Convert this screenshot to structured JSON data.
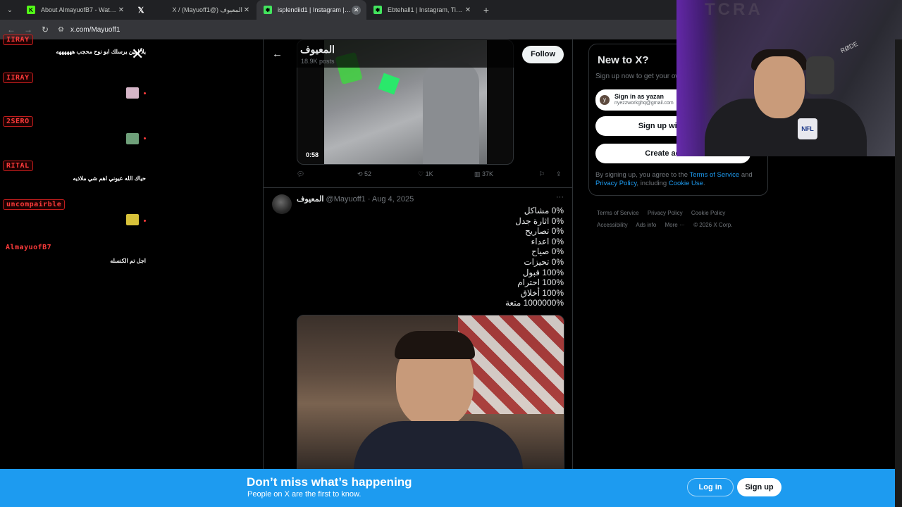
{
  "browser": {
    "tabs": [
      {
        "title": "About AlmayuofB7 - Watch Live",
        "icon": "kick-icon"
      },
      {
        "title": "",
        "icon": "x-icon"
      },
      {
        "title": "X / (Mayuoff1@) المعيوف",
        "icon": ""
      },
      {
        "title": "isplendiid1 | Instagram | Linktree",
        "icon": "linktree-icon"
      },
      {
        "title": "Ebtehall1 | Instagram, TikTok | L",
        "icon": "linktree-icon"
      }
    ],
    "url": "x.com/Mayuoff1"
  },
  "chat": [
    {
      "user": "IIRAY",
      "message": "يلاً امين يرسلك ابو نوح محجب ههههههه"
    },
    {
      "user": "IIRAY",
      "message": ""
    },
    {
      "user": "2SERO",
      "message": ""
    },
    {
      "user": "RITAL",
      "message": "حياك الله عيوني اهم شي ملاذيه"
    },
    {
      "user": "uncompairble",
      "message": ""
    },
    {
      "user": "AlmayuofB7",
      "message": "اجل تم الكنسله"
    }
  ],
  "profile": {
    "name": "المعيوف",
    "posts": "18.9K posts",
    "follow_label": "Follow"
  },
  "tweet1": {
    "duration": "0:58",
    "retweets": "52",
    "likes": "1K",
    "views": "37K"
  },
  "tweet2": {
    "author": "المعيوف",
    "handle_date": "@Mayuoff1 · Aug 4, 2025",
    "lines": [
      "0% مشاكل",
      "0% اثارة جدل",
      "0% تصاريح",
      "0% اعداء",
      "0% صياح",
      "0% تحيزات",
      "100% قبول",
      "100% احترام",
      "100% أخلاق",
      "1000000% متعة"
    ]
  },
  "sidebar": {
    "title": "New to X?",
    "subtitle": "Sign up now to get your own personalized timeline!",
    "google_name": "Sign in as yazan",
    "google_email": "nyezzworkghq@gmail.com",
    "google_initial": "y",
    "apple_label": "Sign up with Apple",
    "create_label": "Create account",
    "legal_pre": "By signing up, you agree to the ",
    "legal_tos": "Terms of Service",
    "legal_and": " and ",
    "legal_privacy": "Privacy Policy",
    "legal_mid": ", including ",
    "legal_cookie": "Cookie Use",
    "legal_end": ".",
    "footer": [
      "Terms of Service",
      "Privacy Policy",
      "Cookie Policy",
      "Accessibility",
      "Ads info",
      "More ···",
      "© 2026 X Corp."
    ]
  },
  "banner": {
    "headline": "Don’t miss what’s happening",
    "sub": "People on X are the first to know.",
    "login": "Log in",
    "signup": "Sign up"
  },
  "colors": {
    "accent": "#1d9bf0",
    "chat_red": "#ff3b3b"
  }
}
